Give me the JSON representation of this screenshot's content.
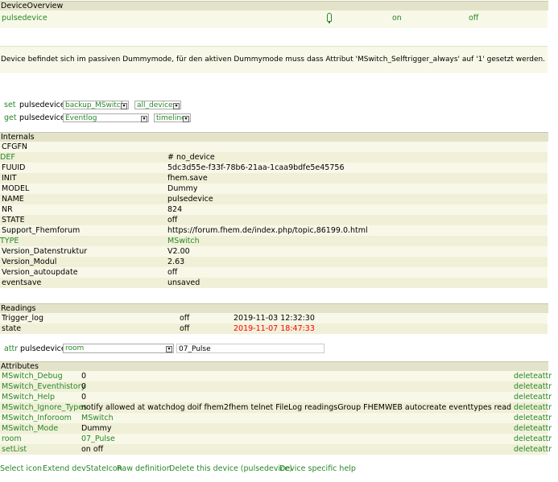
{
  "device_overview": {
    "title": "DeviceOverview",
    "device_name": "pulsedevice",
    "state_icon": "lightbulb-icon",
    "cmd_on": "on",
    "cmd_off": "off"
  },
  "notice": "Device befindet sich im passiven Dummymode, für den aktiven Dummymode muss dass Attribut 'MSwitch_Selftrigger_always' auf '1' gesetzt werden.",
  "set_row": {
    "label": "set",
    "device": "pulsedevice",
    "select1": "backup_MSwitch",
    "select2": "all_devices"
  },
  "get_row": {
    "label": "get",
    "device": "pulsedevice",
    "select1": "Eventlog",
    "select2": "timeline"
  },
  "internals": {
    "title": "Internals",
    "rows": [
      {
        "name": "CFGFN",
        "value": ""
      },
      {
        "name": "DEF",
        "value": "# no_device"
      },
      {
        "name": "FUUID",
        "value": "5dc3d55e-f33f-78b6-21aa-1caa9bdfe5e45756"
      },
      {
        "name": "INIT",
        "value": "fhem.save"
      },
      {
        "name": "MODEL",
        "value": "Dummy"
      },
      {
        "name": "NAME",
        "value": "pulsedevice"
      },
      {
        "name": "NR",
        "value": "824"
      },
      {
        "name": "STATE",
        "value": "off"
      },
      {
        "name": "Support_Fhemforum",
        "value": "https://forum.fhem.de/index.php/topic,86199.0.html"
      },
      {
        "name": "TYPE",
        "value": "MSwitch"
      },
      {
        "name": "Version_Datenstruktur",
        "value": "V2.00"
      },
      {
        "name": "Version_Modul",
        "value": "2.63"
      },
      {
        "name": "Version_autoupdate",
        "value": "off"
      },
      {
        "name": "eventsave",
        "value": "unsaved"
      }
    ]
  },
  "readings": {
    "title": "Readings",
    "rows": [
      {
        "name": "Trigger_log",
        "value": "off",
        "time": "2019-11-03 12:32:30"
      },
      {
        "name": "state",
        "value": "off",
        "time": "2019-11-07 18:47:33"
      }
    ]
  },
  "attr_row": {
    "label": "attr",
    "device": "pulsedevice",
    "select": "room",
    "value": "07_Pulse"
  },
  "attributes": {
    "title": "Attributes",
    "delete_label": "deleteattr",
    "rows": [
      {
        "name": "MSwitch_Debug",
        "value": "0"
      },
      {
        "name": "MSwitch_Eventhistory",
        "value": "0"
      },
      {
        "name": "MSwitch_Help",
        "value": "0"
      },
      {
        "name": "MSwitch_Ignore_Types",
        "value": "notify allowed at watchdog doif fhem2fhem telnet FileLog readingsGroup FHEMWEB autocreate eventtypes readingsproxy svg cul"
      },
      {
        "name": "MSwitch_Inforoom",
        "value": "MSwitch"
      },
      {
        "name": "MSwitch_Mode",
        "value": "Dummy"
      },
      {
        "name": "room",
        "value": "07_Pulse"
      },
      {
        "name": "setList",
        "value": "on off"
      }
    ]
  },
  "footer_links": [
    "Select icon",
    "Extend devStateIcon",
    "Raw definition",
    "Delete this device (pulsedevice)",
    "Device specific help"
  ],
  "colors": {
    "link": "#278727",
    "alert_time": "#ff0000",
    "header_bg": "#e3e3ca"
  }
}
